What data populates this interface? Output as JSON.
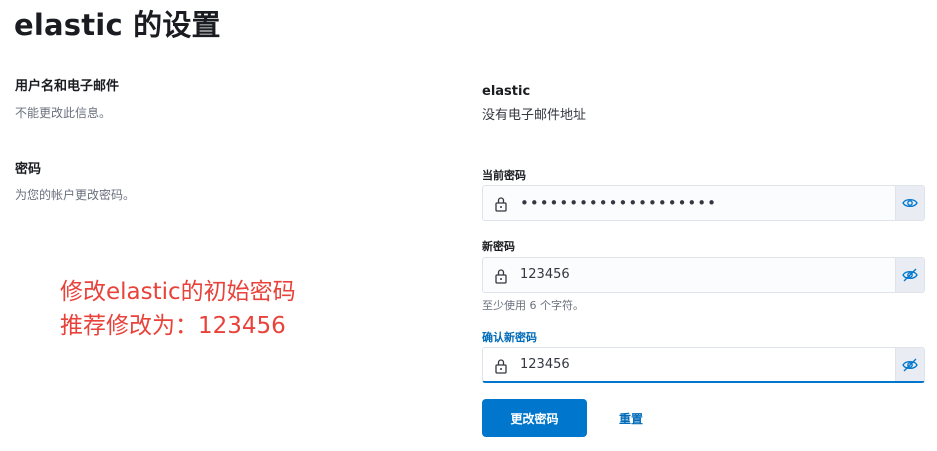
{
  "page": {
    "title": "elastic 的设置"
  },
  "username_section": {
    "title": "用户名和电子邮件",
    "description": "不能更改此信息。",
    "username": "elastic",
    "email": "没有电子邮件地址"
  },
  "password_section": {
    "title": "密码",
    "description": "为您的帐户更改密码。",
    "current_password": {
      "label": "当前密码",
      "value": "••••••••••••••••••••",
      "icon": "eye-icon"
    },
    "new_password": {
      "label": "新密码",
      "value": "123456",
      "help": "至少使用 6 个字符。",
      "icon": "eye-slash-icon"
    },
    "confirm_password": {
      "label": "确认新密码",
      "value": "123456",
      "icon": "eye-slash-icon"
    },
    "submit_label": "更改密码",
    "reset_label": "重置"
  },
  "annotation": {
    "line1": "修改elastic的初始密码",
    "line2": "推荐修改为：123456",
    "color": "#e8423a"
  },
  "colors": {
    "primary": "#0077cc",
    "link": "#006bb8",
    "field_bg": "#fbfcfd",
    "append_bg": "#e9edf3"
  }
}
